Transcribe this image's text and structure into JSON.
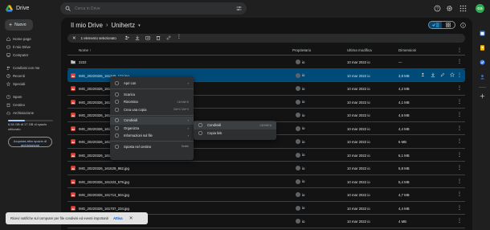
{
  "app": {
    "name": "Drive"
  },
  "search": {
    "placeholder": "Cerca in Drive"
  },
  "user": {
    "initials": "GS"
  },
  "sidebar": {
    "new_label": "Nuovo",
    "items": [
      {
        "label": "Home page",
        "icon": "home-icon"
      },
      {
        "label": "Il mio Drive",
        "icon": "drive-icon"
      },
      {
        "label": "Computer",
        "icon": "computer-icon"
      },
      {
        "label": "Condivisi con me",
        "icon": "people-icon"
      },
      {
        "label": "Recenti",
        "icon": "clock-icon"
      },
      {
        "label": "Speciali",
        "icon": "star-icon"
      },
      {
        "label": "Spam",
        "icon": "spam-icon"
      },
      {
        "label": "Cestino",
        "icon": "trash-icon"
      },
      {
        "label": "Archiviazione",
        "icon": "cloud-icon"
      }
    ],
    "storage_text": "6,54 GB di 17 GB di spazio utilizzato",
    "storage_fraction": 0.38,
    "buy_storage_label": "Acquista altro spazio di archiviazione"
  },
  "breadcrumb": {
    "root": "Il mio Drive",
    "current": "Unihertz"
  },
  "selection": {
    "label": "1 elemento selezionato"
  },
  "columns": {
    "name": "Nome",
    "owner": "Proprietario",
    "modified": "Ultima modifica",
    "size": "Dimensioni"
  },
  "rows": [
    {
      "name": "2222",
      "type": "folder",
      "owner": "io",
      "modified": "10 mar 2022 io",
      "size": "—"
    },
    {
      "name": "IMG_20220326_161345_174.jpg",
      "type": "image",
      "owner": "io",
      "modified": "10 mar 2022 io",
      "size": "3,9 MB",
      "selected": true
    },
    {
      "name": "IMG_20220326_161435_521.jpg",
      "type": "image",
      "owner": "io",
      "modified": "10 mar 2022 io",
      "size": "4,2 MB"
    },
    {
      "name": "IMG_20220326_161455_004.jpg",
      "type": "image",
      "owner": "io",
      "modified": "10 mar 2022 io",
      "size": "4,1 MB"
    },
    {
      "name": "IMG_20220326_161520_177.jpg",
      "type": "image",
      "owner": "io",
      "modified": "10 mar 2022 io",
      "size": "4,5 MB"
    },
    {
      "name": "IMG_20220326_161530_002.jpg",
      "type": "image",
      "owner": "io",
      "modified": "10 mar 2022 io",
      "size": "4,4 MB"
    },
    {
      "name": "IMG_20220326_161538_214.jpg",
      "type": "image",
      "owner": "io",
      "modified": "10 mar 2022 io",
      "size": "6 MB"
    },
    {
      "name": "IMG_20220326_161540_990.jpg",
      "type": "image",
      "owner": "io",
      "modified": "10 mar 2022 io",
      "size": "6,1 MB"
    },
    {
      "name": "IMG_20220326_161529_862.jpg",
      "type": "image",
      "owner": "io",
      "modified": "10 mar 2022 io",
      "size": "5,8 MB"
    },
    {
      "name": "IMG_20220326_161323_579.jpg",
      "type": "image",
      "owner": "io",
      "modified": "10 mar 2022 io",
      "size": "5,4 MB"
    },
    {
      "name": "IMG_20220326_161713_504.jpg",
      "type": "image",
      "owner": "io",
      "modified": "10 mar 2022 io",
      "size": "4,7 MB"
    },
    {
      "name": "IMG_20220326_161707_234.jpg",
      "type": "image",
      "owner": "io",
      "modified": "10 mar 2022 io",
      "size": "4,4 MB"
    },
    {
      "name": "IMG_20220326_161712_440.jpg",
      "type": "image",
      "owner": "io",
      "modified": "10 mar 2022 io",
      "size": "4 MB"
    },
    {
      "name": "IMG_20220326_161718_108.jpg",
      "type": "image",
      "owner": "io",
      "modified": "10 mar 2022 io",
      "size": "4,4 MB"
    }
  ],
  "context_menu": {
    "items": [
      {
        "label": "Apri con",
        "icon": "open-with-icon",
        "arrow": "›"
      },
      {
        "sep": true
      },
      {
        "label": "Scarica",
        "icon": "download-icon"
      },
      {
        "label": "Rinomina",
        "icon": "rename-icon",
        "shortcut": "Ctrl+Alt+E"
      },
      {
        "label": "Crea una copia",
        "icon": "copy-icon",
        "shortcut": "Ctrl+C Ctrl+V"
      },
      {
        "sep": true
      },
      {
        "label": "Condividi",
        "icon": "share-icon",
        "arrow": "›",
        "hover": true
      },
      {
        "label": "Organizza",
        "icon": "organize-icon",
        "arrow": "›"
      },
      {
        "label": "Informazioni sul file",
        "icon": "info-icon",
        "arrow": "›"
      },
      {
        "sep": true
      },
      {
        "label": "Sposta nel cestino",
        "icon": "trash-icon",
        "shortcut": "Delete"
      }
    ]
  },
  "submenu": {
    "items": [
      {
        "label": "Condividi",
        "icon": "share-icon",
        "shortcut": "Ctrl+Alt+A",
        "hover": true
      },
      {
        "label": "Copia link",
        "icon": "link-icon"
      }
    ]
  },
  "snackbar": {
    "text": "Ricevi notifiche sul computer per file condivisi ed eventi importanti",
    "action": "Attiva",
    "close": "✕"
  },
  "colors": {
    "accent": "#a8c7fa",
    "selected_row": "#004a77",
    "image_icon": "#ea4335",
    "folder_icon": "#c4c7c5"
  }
}
